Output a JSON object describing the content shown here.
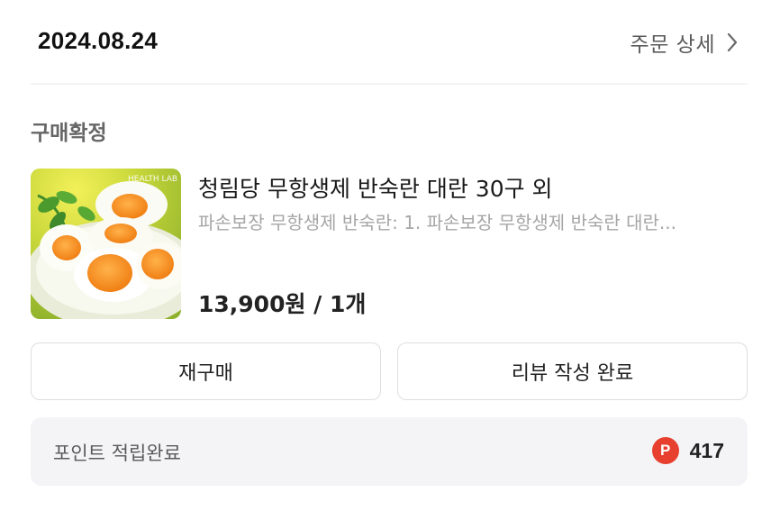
{
  "order": {
    "date": "2024.08.24",
    "detail_link_label": "주문 상세",
    "status": "구매확정"
  },
  "product": {
    "name": "청림당 무항생제 반숙란 대란 30구 외",
    "option": "파손보장 무항생제 반숙란: 1. 파손보장 무항생제 반숙란 대란...",
    "price_line": "13,900원 / 1개",
    "thumbnail_watermark": "HEALTH LAB"
  },
  "actions": {
    "rebuy_label": "재구매",
    "review_label": "리뷰 작성 완료"
  },
  "points": {
    "label": "포인트 적립완료",
    "badge_letter": "P",
    "value": "417"
  },
  "colors": {
    "point_badge": "#e8402f",
    "points_bar_bg": "#f4f4f6",
    "button_border": "#dedede"
  },
  "icons": {
    "detail_chevron": "chevron-right-icon",
    "point_badge": "point-badge-icon"
  }
}
